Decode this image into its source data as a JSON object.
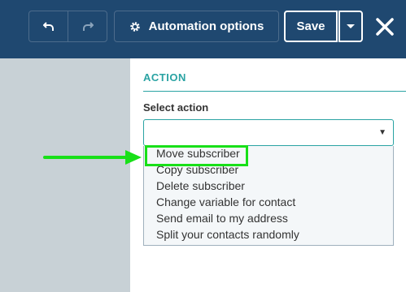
{
  "toolbar": {
    "automation_options_label": "Automation options",
    "save_label": "Save"
  },
  "icons": {
    "undo": "undo-icon",
    "redo": "redo-icon",
    "gear": "gear-icon",
    "caret": "chevron-down-icon",
    "close": "close-icon"
  },
  "action": {
    "section_title": "ACTION",
    "select_label": "Select action",
    "selected_value": "",
    "options": [
      "Move subscriber",
      "Copy subscriber",
      "Delete subscriber",
      "Change variable for contact",
      "Send email to my address",
      "Split your contacts randomly"
    ]
  },
  "colors": {
    "topbar": "#1f4870",
    "accent": "#2aa3a3",
    "annotation": "#18e018"
  }
}
